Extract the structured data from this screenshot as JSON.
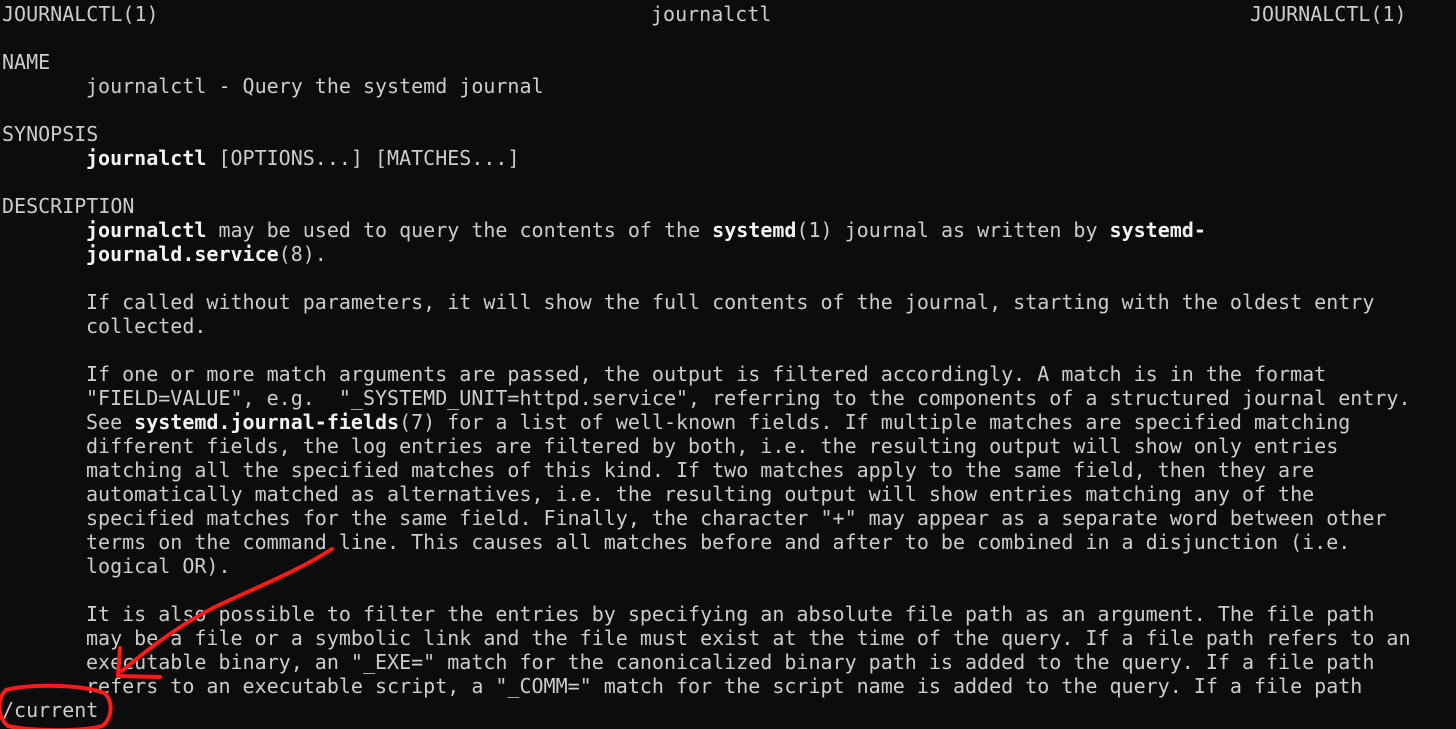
{
  "header": {
    "left": "JOURNALCTL(1)",
    "center": "journalctl",
    "right": "JOURNALCTL(1)"
  },
  "sections": {
    "name": "NAME",
    "synopsis": "SYNOPSIS",
    "description": "DESCRIPTION"
  },
  "name_line": "journalctl - Query the systemd journal",
  "synopsis_line": {
    "cmd": "journalctl",
    "args": " [OPTIONS...] [MATCHES...]"
  },
  "desc_p1": {
    "l1_a": "journalctl",
    "l1_b": " may be used to query the contents of the ",
    "l1_c": "systemd",
    "l1_d": "(1) journal as written by ",
    "l1_e": "systemd-",
    "l2_a": "journald.service",
    "l2_b": "(8)."
  },
  "desc_p2": [
    "If called without parameters, it will show the full contents of the journal, starting with the oldest entry",
    "collected."
  ],
  "desc_p3": {
    "l1": "If one or more match arguments are passed, the output is filtered accordingly. A match is in the format",
    "l2": "\"FIELD=VALUE\", e.g.  \"_SYSTEMD_UNIT=httpd.service\", referring to the components of a structured journal entry.",
    "l3_a": "See ",
    "l3_b": "systemd.journal-fields",
    "l3_c": "(7) for a list of well-known fields. If multiple matches are specified matching",
    "l4": "different fields, the log entries are filtered by both, i.e. the resulting output will show only entries",
    "l5": "matching all the specified matches of this kind. If two matches apply to the same field, then they are",
    "l6": "automatically matched as alternatives, i.e. the resulting output will show entries matching any of the",
    "l7": "specified matches for the same field. Finally, the character \"+\" may appear as a separate word between other",
    "l8": "terms on the command line. This causes all matches before and after to be combined in a disjunction (i.e.",
    "l9": "logical OR)."
  },
  "desc_p4": [
    "It is also possible to filter the entries by specifying an absolute file path as an argument. The file path",
    "may be a file or a symbolic link and the file must exist at the time of the query. If a file path refers to an",
    "executable binary, an \"_EXE=\" match for the canonicalized binary path is added to the query. If a file path",
    "refers to an executable script, a \"_COMM=\" match for the script name is added to the query. If a file path"
  ],
  "prompt": "/current",
  "annotation": {
    "color": "#ff1a1a",
    "marks": [
      "arrow-icon",
      "circle-highlight"
    ]
  }
}
